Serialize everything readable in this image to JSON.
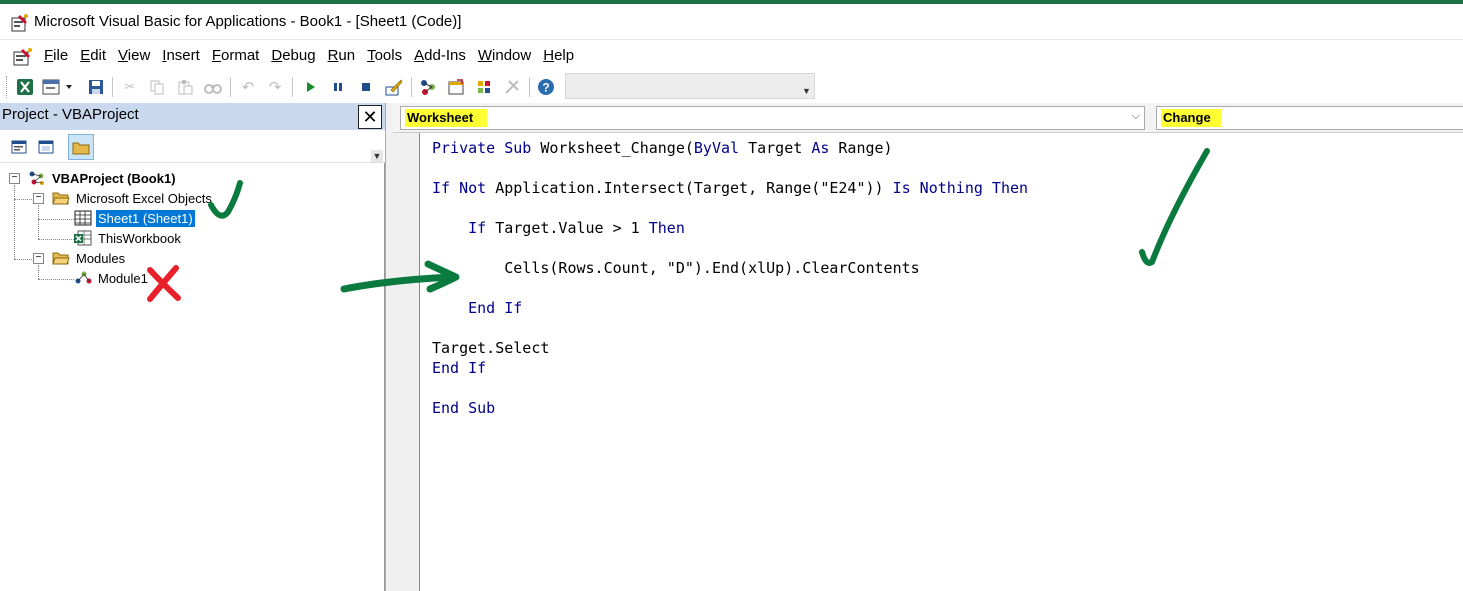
{
  "window": {
    "title": "Microsoft Visual Basic for Applications - Book1 - [Sheet1 (Code)]"
  },
  "menu": {
    "items": [
      {
        "mnemonic": "F",
        "rest": "ile"
      },
      {
        "mnemonic": "E",
        "rest": "dit"
      },
      {
        "mnemonic": "V",
        "rest": "iew"
      },
      {
        "mnemonic": "I",
        "rest": "nsert"
      },
      {
        "mnemonic": "F",
        "rest": "ormat",
        "mnemonic_index": 1
      },
      {
        "mnemonic": "D",
        "rest": "ebug"
      },
      {
        "mnemonic": "R",
        "rest": "un"
      },
      {
        "mnemonic": "T",
        "rest": "ools"
      },
      {
        "mnemonic": "A",
        "rest": "dd-Ins"
      },
      {
        "mnemonic": "W",
        "rest": "indow"
      },
      {
        "mnemonic": "H",
        "rest": "elp"
      }
    ]
  },
  "toolbar": {
    "icons": [
      "excel-view-icon",
      "insert-module-icon",
      "save-icon",
      "cut-icon",
      "copy-icon",
      "paste-icon",
      "find-icon",
      "undo-icon",
      "redo-icon",
      "run-icon",
      "break-icon",
      "reset-icon",
      "design-mode-icon",
      "project-explorer-icon",
      "properties-icon",
      "object-browser-icon",
      "toolbox-icon",
      "help-icon"
    ]
  },
  "project": {
    "title": "Project - VBAProject",
    "close_glyph": "✕",
    "tree": {
      "root": "VBAProject (Book1)",
      "excel_objects_folder": "Microsoft Excel Objects",
      "sheet1": "Sheet1 (Sheet1)",
      "thisworkbook": "ThisWorkbook",
      "modules_folder": "Modules",
      "module1": "Module1"
    }
  },
  "code": {
    "object_combo": "Worksheet",
    "procedure_combo": "Change",
    "lines": [
      [
        {
          "t": "Private Sub",
          "k": true
        },
        {
          "t": " Worksheet_Change("
        },
        {
          "t": "ByVal",
          "k": true
        },
        {
          "t": " Target "
        },
        {
          "t": "As",
          "k": true
        },
        {
          "t": " Range)"
        }
      ],
      [],
      [
        {
          "t": "If Not",
          "k": true
        },
        {
          "t": " Application.Intersect(Target, Range(\"E24\")) "
        },
        {
          "t": "Is Nothing Then",
          "k": true
        }
      ],
      [],
      [
        {
          "t": "    "
        },
        {
          "t": "If",
          "k": true
        },
        {
          "t": " Target.Value > 1 "
        },
        {
          "t": "Then",
          "k": true
        }
      ],
      [],
      [
        {
          "t": "        Cells(Rows.Count, \"D\").End(xlUp).ClearContents"
        }
      ],
      [],
      [
        {
          "t": "    "
        },
        {
          "t": "End If",
          "k": true
        }
      ],
      [],
      [
        {
          "t": "Target.Select"
        }
      ],
      [
        {
          "t": "End If",
          "k": true
        }
      ],
      [],
      [
        {
          "t": "End Sub",
          "k": true
        }
      ]
    ]
  },
  "annotation_colors": {
    "check": "#0b7a3f",
    "cross": "#e8202a",
    "highlight": "#ffff33"
  }
}
